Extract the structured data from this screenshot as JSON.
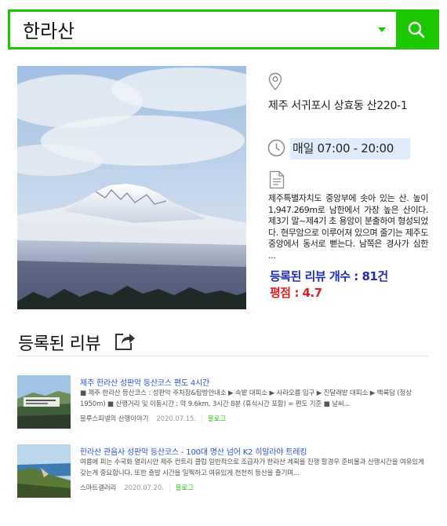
{
  "search": {
    "query": "한라산"
  },
  "place": {
    "address": "제주 서귀포시 상효동 산220-1",
    "hours": "매일 07:00 - 20:00",
    "description": "제주특별자치도 중앙부에 솟아 있는 산. 높이 1,947.269m로 남한에서 가장 높은 산이다. 제3기 말~제4기 초 용암이 분출하여 형성되었다. 현무암으로 이루어져 있으며 줄기는 제주도 중앙에서 동서로 뻗는다. 남쪽은 경사가 심한 ...",
    "review_count": "등록된 리뷰 개수 : 81건",
    "rating": "평점 : 4.7"
  },
  "reviews_section": {
    "title": "등록된 리뷰"
  },
  "reviews": [
    {
      "title": "제주 한라산 성판악 등산코스 편도 4시간",
      "snippet": "■ 제주 한라산 등산코스 : 성판악 주차장&탐방안내소 ▶ 속밭 대피소 ▶ 사라오름 입구 ▶ 진달래밭 대피소 ▶ 백록담 (정상 1950m) ■ 산행거리 및 이동시간 : 약 9.6km, 3시간 8분 (휴식시간 포함) = 편도 기준 ■ 날씨...",
      "author": "블루스피넬의 산행이야기",
      "date": "2020.07.15.",
      "type": "블로그"
    },
    {
      "title": "한라산 관음사 성판악 등산코스 - 100대 명산 넘어 K2 히말라야 트레킹",
      "snippet": "여름에 피는 수국화 열리시안 제주 컨트리 클럽 일반적으로 조급자가 한라산 계획을 진행 할경우 준비물과 산행시간을 여유있게 갖는게 중요합니다. 또한 출발 시간을 일찍하고 여유있게 천천히 등산을 즐기며...",
      "author": "스마트갤러리",
      "date": "2020.07.20.",
      "type": "블로그"
    }
  ]
}
